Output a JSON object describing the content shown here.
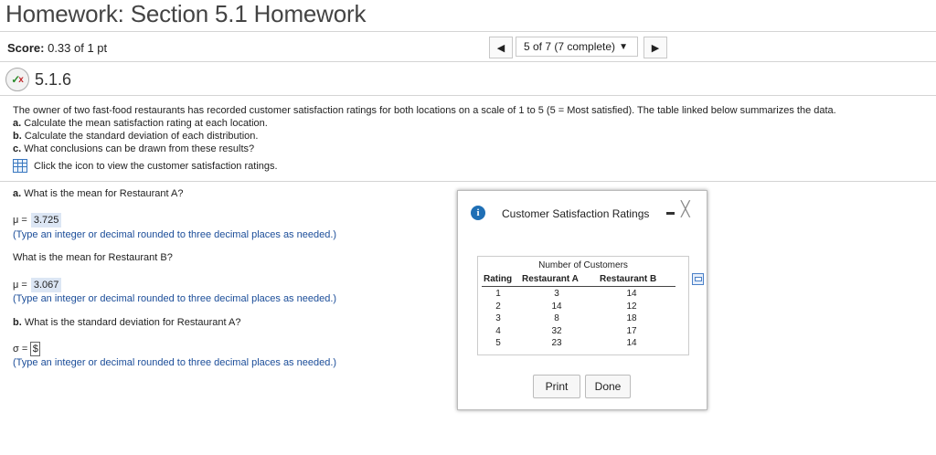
{
  "header": {
    "title": "Homework: Section 5.1 Homework"
  },
  "score": {
    "label": "Score:",
    "value": "0.33 of 1 pt"
  },
  "nav": {
    "prev": "◀",
    "position": "5 of 7 (7 complete)",
    "caret": "▼",
    "next": "▶"
  },
  "question": {
    "number": "5.1.6"
  },
  "problem": {
    "intro": "The owner of two fast-food restaurants has recorded customer satisfaction ratings for both locations on a scale of 1 to 5 (5 = Most satisfied). The table linked below summarizes the data.",
    "a_label": "a.",
    "a_text": "Calculate the mean satisfaction rating at each location.",
    "b_label": "b.",
    "b_text": "Calculate the standard deviation of each distribution.",
    "c_label": "c.",
    "c_text": "What conclusions can be drawn from these results?",
    "table_link": "Click the icon to view the customer satisfaction ratings."
  },
  "parts": {
    "qa_label": "a.",
    "qa_text": "What is the mean for Restaurant A?",
    "mu_symbol": "μ =",
    "mu_a": "3.725",
    "hint1": "(Type an integer or decimal rounded to three decimal places as needed.)",
    "qb_text": "What is the mean for Restaurant B?",
    "mu_b": "3.067",
    "hint2": "(Type an integer or decimal rounded to three decimal places as needed.)",
    "qsd_label": "b.",
    "qsd_text": "What is the standard deviation for Restaurant A?",
    "sigma_symbol": "σ =",
    "sigma_input": "$",
    "hint3": "(Type an integer or decimal rounded to three decimal places as needed.)"
  },
  "popup": {
    "info": "i",
    "title": "Customer Satisfaction Ratings",
    "close": "╳",
    "table": {
      "group_header": "Number of Customers",
      "columns": [
        "Rating",
        "Restaurant A",
        "Restaurant B"
      ],
      "ratings": [
        "1",
        "2",
        "3",
        "4",
        "5"
      ],
      "restaurant_a": [
        "3",
        "14",
        "8",
        "32",
        "23"
      ],
      "restaurant_b": [
        "14",
        "12",
        "18",
        "17",
        "14"
      ]
    },
    "print": "Print",
    "done": "Done"
  }
}
